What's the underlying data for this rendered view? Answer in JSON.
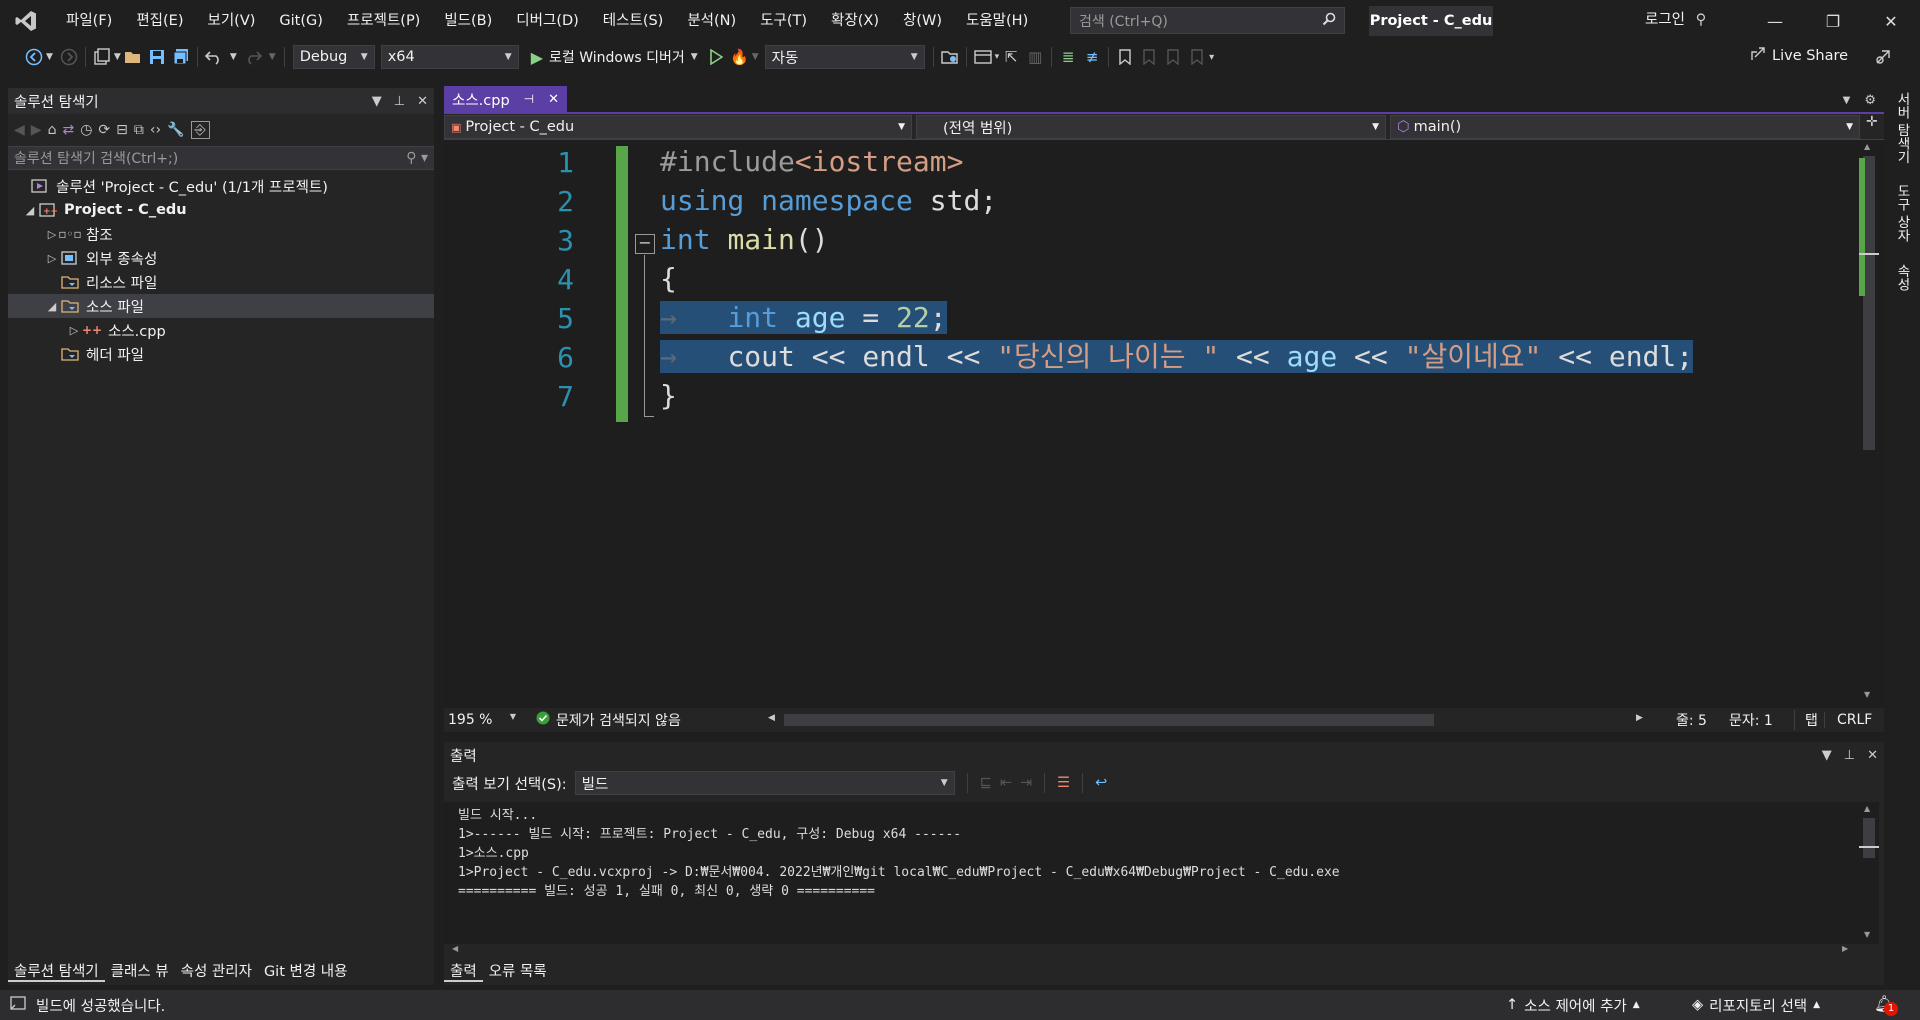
{
  "titlebar": {
    "menu": [
      "파일(F)",
      "편집(E)",
      "보기(V)",
      "Git(G)",
      "프로젝트(P)",
      "빌드(B)",
      "디버그(D)",
      "테스트(S)",
      "분석(N)",
      "도구(T)",
      "확장(X)",
      "창(W)",
      "도움말(H)"
    ],
    "search_placeholder": "검색 (Ctrl+Q)",
    "project_title": "Project - C_edu",
    "login": "로그인"
  },
  "toolbar": {
    "config": "Debug",
    "platform": "x64",
    "run_label": "로컬 Windows 디버거",
    "mode": "자동",
    "live_share": "Live Share"
  },
  "solution_explorer": {
    "title": "솔루션 탐색기",
    "search_placeholder": "솔루션 탐색기 검색(Ctrl+;)",
    "solution": "솔루션 'Project - C_edu' (1/1개 프로젝트)",
    "project": "Project - C_edu",
    "items": [
      {
        "label": "참조",
        "expander": "▷"
      },
      {
        "label": "외부 종속성",
        "expander": "▷"
      },
      {
        "label": "리소스 파일",
        "expander": ""
      },
      {
        "label": "소스 파일",
        "expander": "◢"
      },
      {
        "label": "소스.cpp",
        "expander": "▷"
      },
      {
        "label": "헤더 파일",
        "expander": ""
      }
    ],
    "bottom_tabs": [
      "솔루션 탐색기",
      "클래스 뷰",
      "속성 관리자",
      "Git 변경 내용"
    ]
  },
  "editor": {
    "tab": "소스.cpp",
    "nav_project": "Project - C_edu",
    "nav_scope": "(전역 범위)",
    "nav_member": "main()",
    "line_numbers": [
      "1",
      "2",
      "3",
      "4",
      "5",
      "6",
      "7"
    ],
    "code": {
      "l1_pp": "#include",
      "l1_inc": "<iostream>",
      "l2_using": "using",
      "l2_ns": "namespace",
      "l2_std": "std;",
      "l3_int": "int",
      "l3_main": "main",
      "l3_par": "()",
      "l4": "{",
      "l5_int": "int",
      "l5_age": "age",
      "l5_eq": " = ",
      "l5_num": "22",
      "l5_semi": ";",
      "l6_cout": "cout",
      "l6_op1": " << ",
      "l6_endl1": "endl",
      "l6_op2": " << ",
      "l6_str1": "\"당신의 나이는 \"",
      "l6_op3": " << ",
      "l6_age": "age",
      "l6_op4": " << ",
      "l6_str2": "\"살이네요\"",
      "l6_op5": " << ",
      "l6_endl2": "endl;",
      "l7": "}"
    },
    "zoom": "195 %",
    "issues": "문제가 검색되지 않음",
    "line": "줄: 5",
    "char": "문자: 1",
    "indent": "탭",
    "eol": "CRLF"
  },
  "output": {
    "title": "출력",
    "show_label": "출력 보기 선택(S):",
    "source": "빌드",
    "lines": [
      "빌드 시작...",
      "1>------ 빌드 시작: 프로젝트: Project - C_edu, 구성: Debug x64 ------",
      "1>소스.cpp",
      "1>Project - C_edu.vcxproj -> D:₩문서₩004. 2022년₩개인₩git local₩C_edu₩Project - C_edu₩x64₩Debug₩Project - C_edu.exe",
      "========== 빌드: 성공 1, 실패 0, 최신 0, 생략 0 =========="
    ],
    "tabs": [
      "출력",
      "오류 목록"
    ]
  },
  "right_strip": [
    "서버 탐색기",
    "도구 상자",
    "속성"
  ],
  "statusbar": {
    "message": "빌드에 성공했습니다.",
    "source_control": "소스 제어에 추가",
    "repo": "리포지토리 선택",
    "notifications": "1"
  },
  "colors": {
    "accent": "#5b3fa5",
    "selection": "#264f78",
    "changebar": "#57a64a"
  }
}
